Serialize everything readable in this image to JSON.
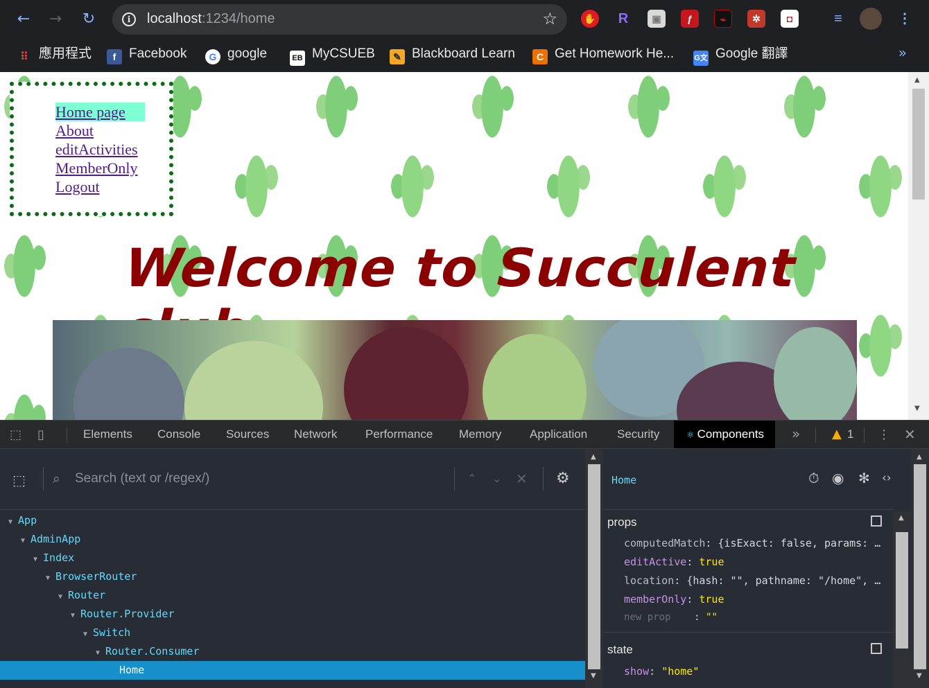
{
  "browser": {
    "url_host": "localhost",
    "url_path": ":1234/home",
    "extensions": [
      "adblock-icon",
      "r-icon",
      "box-icon",
      "flash-icon",
      "pdf-icon",
      "react-icon",
      "mcafee-icon",
      "playlist-icon",
      "profile-avatar",
      "menu-icon"
    ],
    "bookmarks": [
      {
        "label": "應用程式",
        "icon": "apps-grid-icon"
      },
      {
        "label": "Facebook",
        "icon": "facebook-icon"
      },
      {
        "label": "google",
        "icon": "google-icon"
      },
      {
        "label": "MyCSUEB",
        "icon": "eb-icon"
      },
      {
        "label": "Blackboard Learn",
        "icon": "blackboard-icon"
      },
      {
        "label": "Get Homework He...",
        "icon": "chegg-icon"
      },
      {
        "label": "Google 翻譯",
        "icon": "translate-icon"
      }
    ],
    "bookmarks_more": "»"
  },
  "page": {
    "nav": [
      "Home page",
      "About",
      "editActivities",
      "MemberOnly",
      "Logout"
    ],
    "active_nav": "Home page",
    "heading": "Welcome to Succulent club",
    "heading_color": "#8b0000",
    "nav_border_color": "#0b6b17"
  },
  "devtools": {
    "tabs": [
      "Elements",
      "Console",
      "Sources",
      "Network",
      "Performance",
      "Memory",
      "Application",
      "Security",
      "Components"
    ],
    "active_tab": "Components",
    "more": "»",
    "warnings_count": "1",
    "search_placeholder": "Search (text or /regex/)",
    "tree": [
      {
        "name": "App",
        "depth": 0
      },
      {
        "name": "AdminApp",
        "depth": 1
      },
      {
        "name": "Index",
        "depth": 2
      },
      {
        "name": "BrowserRouter",
        "depth": 3
      },
      {
        "name": "Router",
        "depth": 4
      },
      {
        "name": "Router.Provider",
        "depth": 5
      },
      {
        "name": "Switch",
        "depth": 6
      },
      {
        "name": "Router.Consumer",
        "depth": 7
      },
      {
        "name": "Home",
        "depth": 8,
        "selected": true
      }
    ],
    "selected_component": "Home",
    "props_title": "props",
    "props": [
      {
        "key": "computedMatch",
        "value": "{isExact: false, params: …",
        "expandable": true
      },
      {
        "key": "editActive",
        "value": "true"
      },
      {
        "key": "location",
        "value": "{hash: \"\", pathname: \"/home\", …",
        "expandable": true
      },
      {
        "key": "memberOnly",
        "value": "true"
      },
      {
        "key": "new prop",
        "value": "\"\"",
        "placeholder": true
      }
    ],
    "state_title": "state",
    "state": [
      {
        "key": "show",
        "value": "\"home\""
      }
    ]
  }
}
